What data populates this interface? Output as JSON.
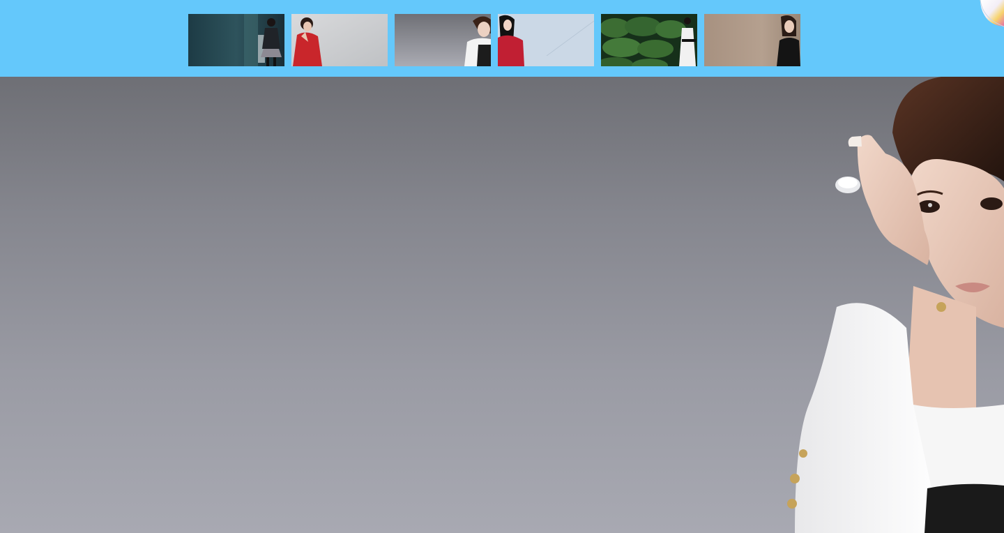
{
  "gallery": {
    "thumbnails": [
      {
        "name": "thumb-1",
        "accent": "#2b4a55"
      },
      {
        "name": "thumb-2",
        "accent": "#c9262b"
      },
      {
        "name": "thumb-3",
        "accent": "#7b7d84"
      },
      {
        "name": "thumb-4",
        "accent": "#c11f33"
      },
      {
        "name": "thumb-5",
        "accent": "#2f5a2a"
      },
      {
        "name": "thumb-6",
        "accent": "#a79180"
      }
    ],
    "selected_index": 2
  },
  "colors": {
    "topbar": "#64c8fb",
    "stage_top": "#6e6f75",
    "stage_bottom": "#a8a9b2"
  },
  "icons": {
    "corner": "page-curl-icon"
  }
}
